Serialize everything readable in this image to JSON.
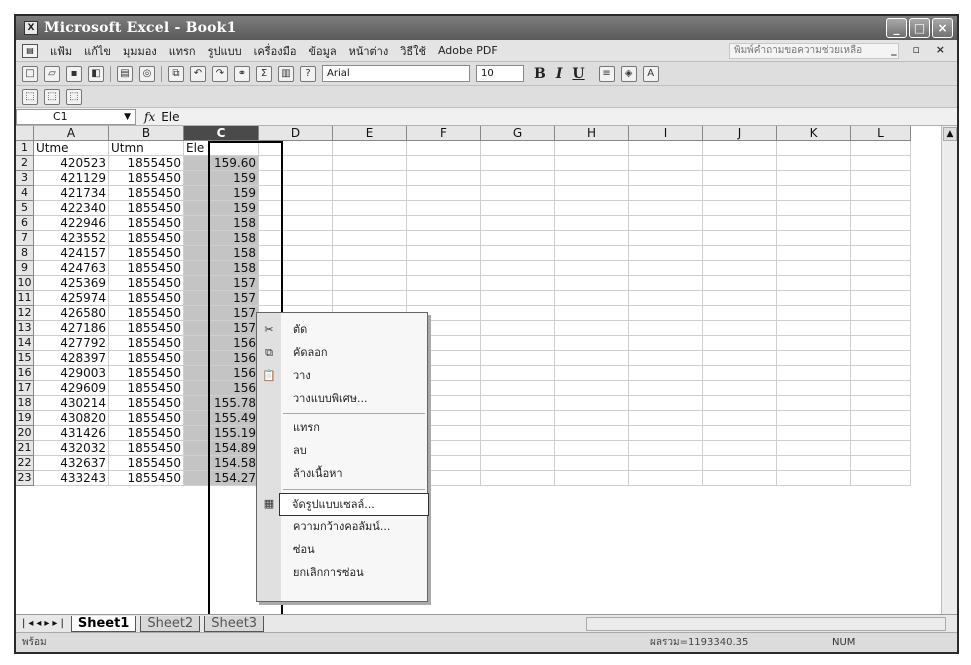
{
  "window": {
    "title": "Microsoft Excel - Book1",
    "buttons": [
      "_",
      "□",
      "×"
    ]
  },
  "menubar": {
    "items": [
      "แฟ้ม",
      "แก้ไข",
      "มุมมอง",
      "แทรก",
      "รูปแบบ",
      "เครื่องมือ",
      "ข้อมูล",
      "หน้าต่าง",
      "วิธีใช้",
      "Adobe PDF"
    ],
    "help_placeholder": "พิมพ์คำถามขอความช่วยเหลือ"
  },
  "toolbar": {
    "font": "Arial",
    "font_size": "10",
    "bold": "B",
    "italic": "I",
    "underline": "U"
  },
  "formula_bar": {
    "cell_ref": "C1",
    "fx": "fx",
    "value": "Ele"
  },
  "sheet": {
    "columns": [
      "A",
      "B",
      "C",
      "D",
      "E",
      "F",
      "G",
      "H",
      "I",
      "J",
      "K",
      "L"
    ],
    "selected_column": "C",
    "rows": [
      {
        "n": "1",
        "a": "Utme",
        "b": "Utmn",
        "c": "Ele"
      },
      {
        "n": "2",
        "a": "420523",
        "b": "1855450",
        "c": "159.60"
      },
      {
        "n": "3",
        "a": "421129",
        "b": "1855450",
        "c": "159"
      },
      {
        "n": "4",
        "a": "421734",
        "b": "1855450",
        "c": "159"
      },
      {
        "n": "5",
        "a": "422340",
        "b": "1855450",
        "c": "159"
      },
      {
        "n": "6",
        "a": "422946",
        "b": "1855450",
        "c": "158"
      },
      {
        "n": "7",
        "a": "423552",
        "b": "1855450",
        "c": "158"
      },
      {
        "n": "8",
        "a": "424157",
        "b": "1855450",
        "c": "158"
      },
      {
        "n": "9",
        "a": "424763",
        "b": "1855450",
        "c": "158"
      },
      {
        "n": "10",
        "a": "425369",
        "b": "1855450",
        "c": "157"
      },
      {
        "n": "11",
        "a": "425974",
        "b": "1855450",
        "c": "157"
      },
      {
        "n": "12",
        "a": "426580",
        "b": "1855450",
        "c": "157"
      },
      {
        "n": "13",
        "a": "427186",
        "b": "1855450",
        "c": "157"
      },
      {
        "n": "14",
        "a": "427792",
        "b": "1855450",
        "c": "156"
      },
      {
        "n": "15",
        "a": "428397",
        "b": "1855450",
        "c": "156"
      },
      {
        "n": "16",
        "a": "429003",
        "b": "1855450",
        "c": "156"
      },
      {
        "n": "17",
        "a": "429609",
        "b": "1855450",
        "c": "156"
      },
      {
        "n": "18",
        "a": "430214",
        "b": "1855450",
        "c": "155.78"
      },
      {
        "n": "19",
        "a": "430820",
        "b": "1855450",
        "c": "155.49"
      },
      {
        "n": "20",
        "a": "431426",
        "b": "1855450",
        "c": "155.19"
      },
      {
        "n": "21",
        "a": "432032",
        "b": "1855450",
        "c": "154.89"
      },
      {
        "n": "22",
        "a": "432637",
        "b": "1855450",
        "c": "154.58"
      },
      {
        "n": "23",
        "a": "433243",
        "b": "1855450",
        "c": "154.27"
      }
    ]
  },
  "context_menu": {
    "items": [
      {
        "label": "ตัด",
        "icon": "scissors-icon",
        "glyph": "✂"
      },
      {
        "label": "คัดลอก",
        "icon": "copy-icon",
        "glyph": "⧉"
      },
      {
        "label": "วาง",
        "icon": "paste-icon",
        "glyph": "📋"
      },
      {
        "label": "วางแบบพิเศษ...",
        "icon": "",
        "glyph": ""
      },
      {
        "label": "แทรก",
        "icon": "",
        "glyph": ""
      },
      {
        "label": "ลบ",
        "icon": "",
        "glyph": ""
      },
      {
        "label": "ล้างเนื้อหา",
        "icon": "",
        "glyph": ""
      },
      {
        "label": "จัดรูปแบบเซลล์...",
        "icon": "format-cells-icon",
        "glyph": "▦"
      },
      {
        "label": "ความกว้างคอลัมน์...",
        "icon": "",
        "glyph": ""
      },
      {
        "label": "ซ่อน",
        "icon": "",
        "glyph": ""
      },
      {
        "label": "ยกเลิกการซ่อน",
        "icon": "",
        "glyph": ""
      }
    ],
    "highlighted": "จัดรูปแบบเซลล์..."
  },
  "sheet_tabs": [
    "Sheet1",
    "Sheet2",
    "Sheet3"
  ],
  "status": {
    "ready": "พร้อม",
    "sum": "ผลรวม=1193340.35",
    "num": "NUM"
  }
}
